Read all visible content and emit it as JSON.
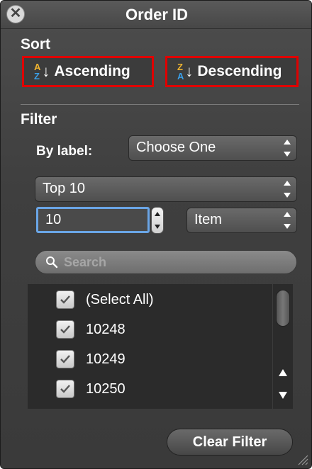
{
  "window": {
    "title": "Order ID",
    "close_icon": "close-icon"
  },
  "sort": {
    "label": "Sort",
    "ascending": {
      "label": "Ascending",
      "icon_top": "A",
      "icon_bottom": "Z"
    },
    "descending": {
      "label": "Descending",
      "icon_top": "Z",
      "icon_bottom": "A"
    },
    "highlight_color": "#e00000"
  },
  "filter": {
    "label": "Filter",
    "by_label": {
      "label": "By label:",
      "selected": "Choose One"
    },
    "top_type": {
      "selected": "Top 10"
    },
    "count": {
      "value": "10"
    },
    "unit": {
      "selected": "Item"
    },
    "search": {
      "placeholder": "Search"
    }
  },
  "list": {
    "items": [
      {
        "label": "(Select All)",
        "checked": true
      },
      {
        "label": "10248",
        "checked": true
      },
      {
        "label": "10249",
        "checked": true
      },
      {
        "label": "10250",
        "checked": true
      }
    ]
  },
  "footer": {
    "clear_label": "Clear Filter"
  },
  "colors": {
    "accent_focus": "#6aa5e6",
    "panel_bg": "#3f3f3f",
    "az_gold": "#f0b430",
    "az_blue": "#3a9fe8"
  }
}
